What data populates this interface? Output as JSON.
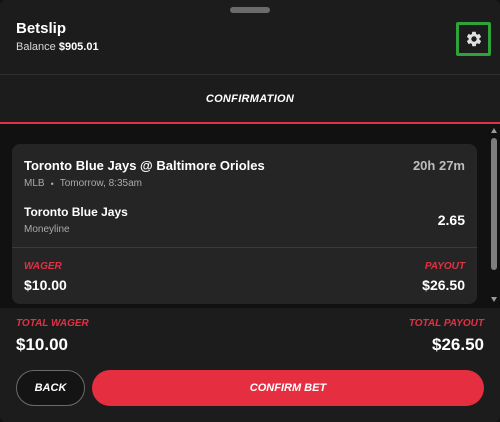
{
  "header": {
    "title": "Betslip",
    "balance_label": "Balance",
    "balance_value": "$905.01"
  },
  "icons": {
    "settings": "gear-icon"
  },
  "tabs": [
    {
      "label": "CONFIRMATION",
      "active": true
    }
  ],
  "bet": {
    "event": "Toronto Blue Jays @ Baltimore Orioles",
    "countdown": "20h 27m",
    "league": "MLB",
    "start_time": "Tomorrow, 8:35am",
    "selection": "Toronto Blue Jays",
    "market": "Moneyline",
    "odds": "2.65",
    "wager_label": "WAGER",
    "wager_value": "$10.00",
    "payout_label": "PAYOUT",
    "payout_value": "$26.50"
  },
  "footer": {
    "total_wager_label": "TOTAL WAGER",
    "total_wager_value": "$10.00",
    "total_payout_label": "TOTAL PAYOUT",
    "total_payout_value": "$26.50",
    "back_label": "BACK",
    "confirm_label": "CONFIRM BET"
  },
  "colors": {
    "accent": "#e52e40",
    "background": "#1c1c1c",
    "card": "#252525",
    "focus_outline": "#2fa33a"
  }
}
